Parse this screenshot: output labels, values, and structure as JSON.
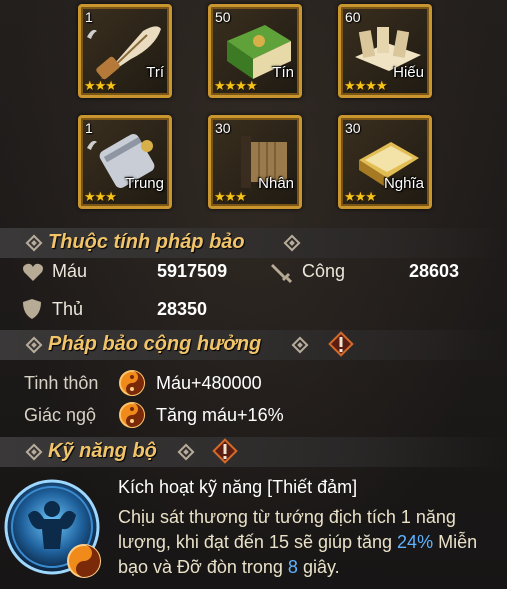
{
  "treasures": [
    {
      "level": "1",
      "name": "Trí",
      "stars": "★★★"
    },
    {
      "level": "50",
      "name": "Tín",
      "stars": "★★★★"
    },
    {
      "level": "60",
      "name": "Hiếu",
      "stars": "★★★★"
    },
    {
      "level": "1",
      "name": "Trung",
      "stars": "★★★"
    },
    {
      "level": "30",
      "name": "Nhân",
      "stars": "★★★"
    },
    {
      "level": "30",
      "name": "Nghĩa",
      "stars": "★★★"
    }
  ],
  "attributes": {
    "title": "Thuộc tính pháp bảo",
    "hp_label": "Máu",
    "hp_value": "5917509",
    "atk_label": "Công",
    "atk_value": "28603",
    "def_label": "Thủ",
    "def_value": "28350"
  },
  "resonance": {
    "title": "Pháp bảo cộng hưởng",
    "rows": [
      {
        "label": "Tinh thôn",
        "value": "Máu+480000"
      },
      {
        "label": "Giác ngộ",
        "value": "Tăng máu+16%"
      }
    ]
  },
  "skill": {
    "section_title": "Kỹ năng bộ",
    "title": "Kích hoạt kỹ năng [Thiết đảm]",
    "desc_1": "Chịu sát thương từ tướng địch tích 1 năng lượng, khi đạt đến 15 sẽ giúp tăng ",
    "pct": "24%",
    "desc_2": " Miễn bạo và Đỡ đòn trong ",
    "secs": "8",
    "desc_3": " giây."
  },
  "colors": {
    "section_title": "#f1c469",
    "highlight": "#5fb3ff",
    "card_border": "#c9952e",
    "star": "#f5c518"
  },
  "icons": [
    "heart-icon",
    "sword-icon",
    "shield-icon",
    "warning-icon",
    "yin-yang-icon",
    "skill-warrior-icon"
  ]
}
